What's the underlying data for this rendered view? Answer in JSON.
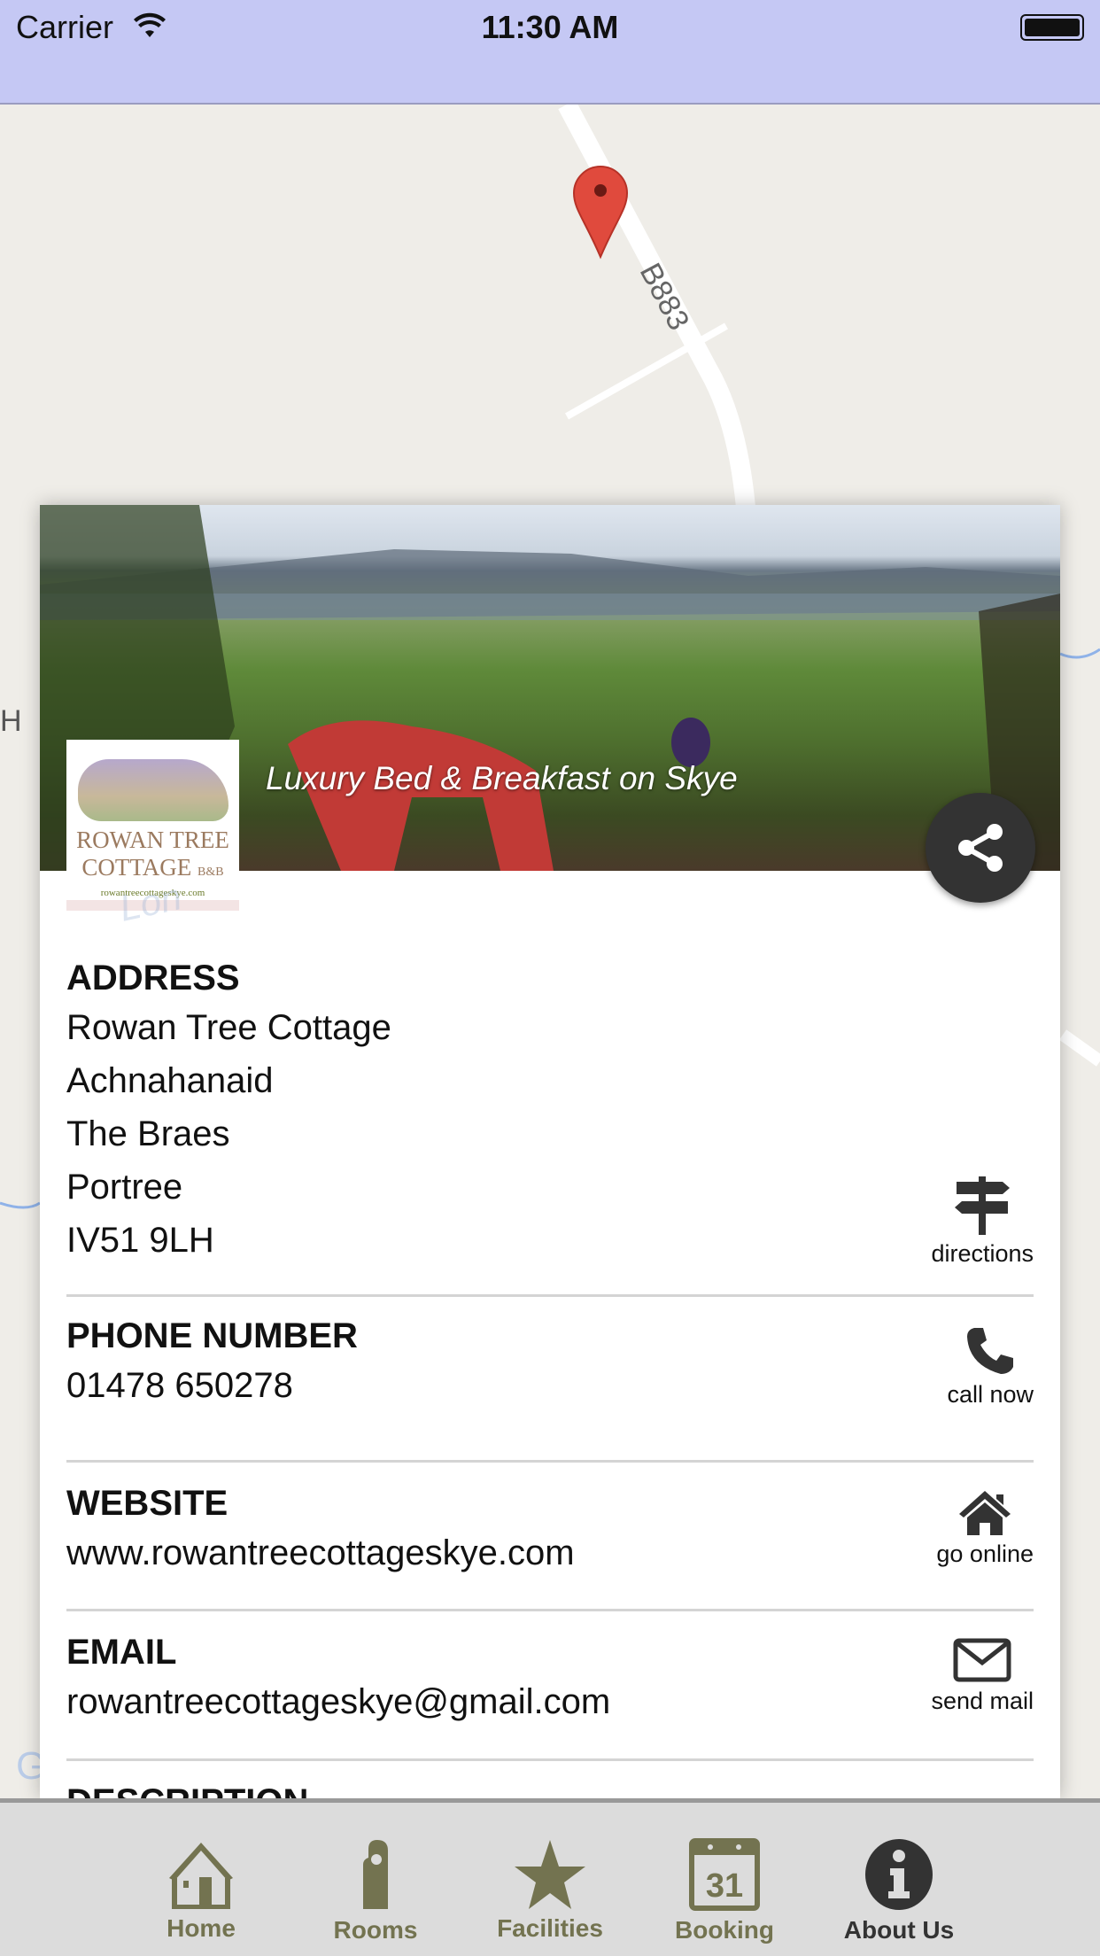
{
  "status_bar": {
    "carrier": "Carrier",
    "time": "11:30 AM"
  },
  "map": {
    "road_label": "B883",
    "partial_label_left": "H",
    "partial_label_card": "Lon",
    "google_watermark": "Google"
  },
  "header": {
    "tagline": "Luxury Bed & Breakfast on Skye",
    "logo": {
      "line1": "Rowan Tree",
      "line2": "Cottage B&B",
      "url": "rowantreecottageskye.com"
    }
  },
  "sections": {
    "address": {
      "title": "ADDRESS",
      "lines": [
        "Rowan Tree Cottage",
        "Achnahanaid",
        "The Braes",
        "Portree",
        "IV51 9LH"
      ],
      "action": "directions"
    },
    "phone": {
      "title": "PHONE NUMBER",
      "value": "01478 650278",
      "action": "call now"
    },
    "website": {
      "title": "WEBSITE",
      "value": "www.rowantreecottageskye.com",
      "action": "go online"
    },
    "email": {
      "title": "EMAIL",
      "value": "rowantreecottageskye@gmail.com",
      "action": "send mail"
    },
    "description": {
      "title": "DESCRIPTION"
    }
  },
  "tabs": [
    {
      "label": "Home",
      "icon": "home-icon"
    },
    {
      "label": "Rooms",
      "icon": "door-hanger-icon"
    },
    {
      "label": "Facilities",
      "icon": "star-icon"
    },
    {
      "label": "Booking",
      "icon": "calendar-icon",
      "day": "31"
    },
    {
      "label": "About Us",
      "icon": "info-icon",
      "active": true
    }
  ],
  "colors": {
    "tab_inactive": "#737350",
    "tab_active": "#333333",
    "status_bar": "#c5c8f4"
  }
}
